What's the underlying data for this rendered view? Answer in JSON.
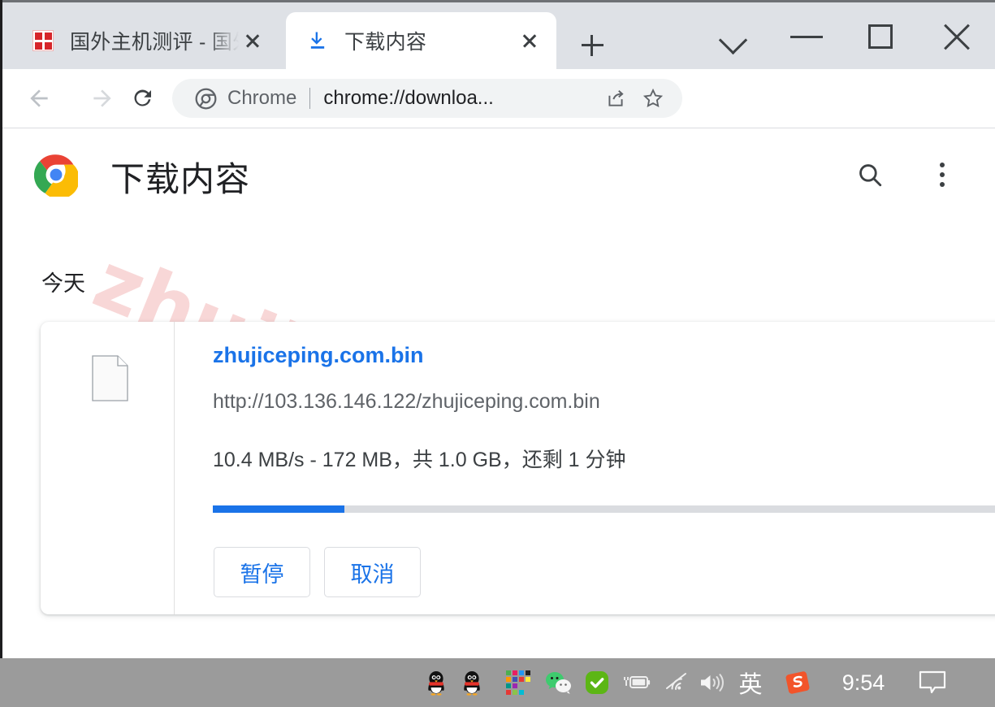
{
  "window": {
    "controls": {
      "tab_search": "tab-search-chevron",
      "minimize": "minimize",
      "maximize": "maximize",
      "close": "close"
    }
  },
  "tabs": [
    {
      "title": "国外主机测评 - 国外",
      "favicon": "red-seal-icon",
      "active": false,
      "close_label": "×"
    },
    {
      "title": "下载内容",
      "favicon": "download-arrow-icon",
      "active": true,
      "close_label": "×"
    }
  ],
  "new_tab_button_label": "+",
  "toolbar": {
    "back_label": "back-arrow-icon",
    "forward_label": "forward-arrow-icon",
    "reload_label": "reload-icon",
    "omnibox": {
      "scheme_label": "Chrome",
      "url": "chrome://downloa...",
      "chrome_badge": "chrome-badge-icon",
      "share_icon": "share-icon",
      "bookmark_icon": "star-icon"
    },
    "menu_icon": "three-dot-menu-icon"
  },
  "page": {
    "title": "下载内容",
    "logo": "chrome-logo-icon",
    "search_icon": "search-icon",
    "menu_icon": "three-dot-menu-icon",
    "watermark": "zhujiceping.com",
    "date_group": "今天",
    "download": {
      "file_icon": "generic-file-icon",
      "file_name": "zhujiceping.com.bin",
      "source_url": "http://103.136.146.122/zhujiceping.com.bin",
      "status": "10.4 MB/s - 172 MB，共 1.0 GB，还剩 1 分钟",
      "speed": "10.4 MB/s",
      "downloaded": "172 MB",
      "total_size": "1.0 GB",
      "time_remaining": "1 分钟",
      "progress_percent": 16,
      "progress_color": "#1a73e8",
      "pause_label": "暂停",
      "cancel_label": "取消"
    }
  },
  "taskbar": {
    "tray": [
      {
        "name": "qq-icon",
        "label": ""
      },
      {
        "name": "qq-icon",
        "label": ""
      },
      {
        "name": "pixel-grid-icon",
        "label": ""
      },
      {
        "name": "wechat-icon",
        "label": ""
      },
      {
        "name": "shield-check-icon",
        "label": ""
      },
      {
        "name": "battery-charging-icon",
        "label": ""
      },
      {
        "name": "wifi-icon",
        "label": ""
      },
      {
        "name": "volume-icon",
        "label": ""
      },
      {
        "name": "ime-language-indicator",
        "label": "英"
      },
      {
        "name": "sogou-icon",
        "label": ""
      }
    ],
    "clock": "9:54",
    "notification_icon": "notification-bubble-icon"
  }
}
